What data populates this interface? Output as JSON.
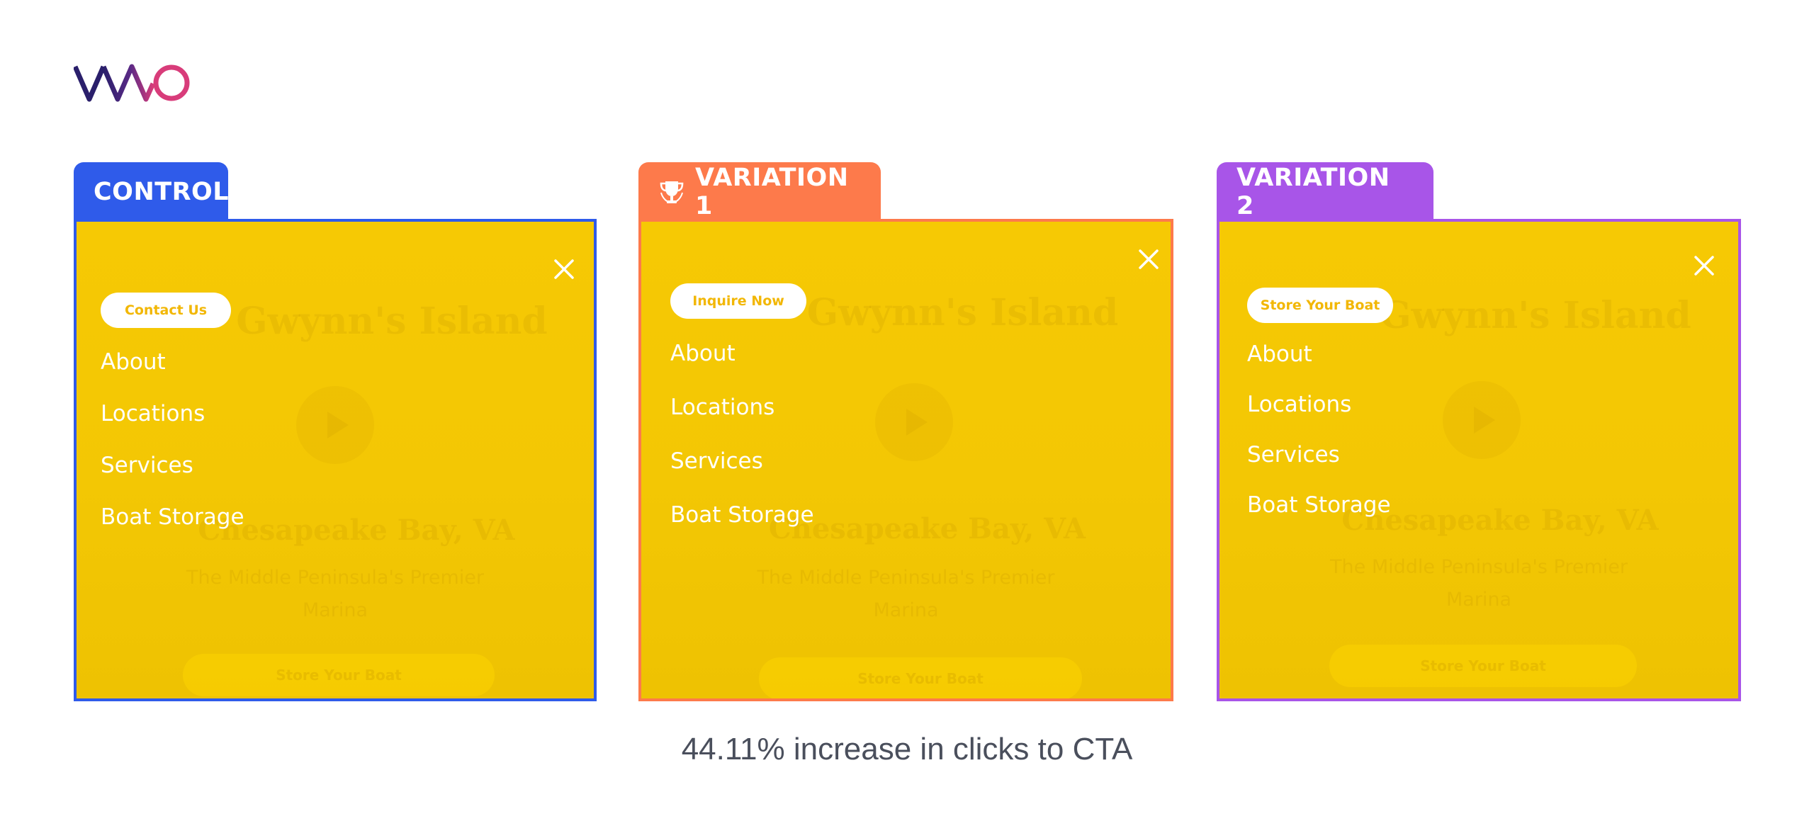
{
  "brand": {
    "logo_text": "VWO"
  },
  "panels": [
    {
      "tab_label": "CONTROL",
      "accent": "#2f5bea",
      "winner": false,
      "cta_label": "Contact Us",
      "menu": [
        "About",
        "Locations",
        "Services",
        "Boat Storage"
      ],
      "background_site": {
        "title": "Gwynn's Island",
        "location": "Chesapeake Bay, VA",
        "tagline": "The Middle Peninsula's Premier Marina",
        "button": "Store Your Boat"
      }
    },
    {
      "tab_label": "VARIATION 1",
      "accent": "#fd7a4b",
      "winner": true,
      "cta_label": "Inquire Now",
      "menu": [
        "About",
        "Locations",
        "Services",
        "Boat Storage"
      ],
      "background_site": {
        "title": "Gwynn's Island",
        "location": "Chesapeake Bay, VA",
        "tagline": "The Middle Peninsula's Premier Marina",
        "button": "Store Your Boat"
      }
    },
    {
      "tab_label": "VARIATION 2",
      "accent": "#a855e8",
      "winner": false,
      "cta_label": "Store Your Boat",
      "menu": [
        "About",
        "Locations",
        "Services",
        "Boat Storage"
      ],
      "background_site": {
        "title": "Gwynn's Island",
        "location": "Chesapeake Bay, VA",
        "tagline": "The Middle Peninsula's Premier Marina",
        "button": "Store Your Boat"
      }
    }
  ],
  "caption": "44.11% increase in clicks to CTA",
  "icons": {
    "close": "close-icon",
    "trophy": "trophy-icon",
    "play": "play-icon"
  }
}
